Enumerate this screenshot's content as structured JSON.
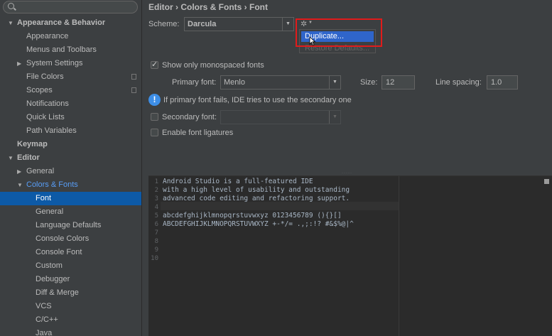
{
  "sidebar": {
    "search_placeholder": "",
    "items": [
      {
        "label": "Appearance & Behavior",
        "level": 0,
        "arrow": "▼",
        "bold": true
      },
      {
        "label": "Appearance",
        "level": 1
      },
      {
        "label": "Menus and Toolbars",
        "level": 1
      },
      {
        "label": "System Settings",
        "level": 1,
        "arrow": "▶"
      },
      {
        "label": "File Colors",
        "level": 1,
        "copy": true
      },
      {
        "label": "Scopes",
        "level": 1,
        "copy": true
      },
      {
        "label": "Notifications",
        "level": 1
      },
      {
        "label": "Quick Lists",
        "level": 1
      },
      {
        "label": "Path Variables",
        "level": 1
      },
      {
        "label": "Keymap",
        "level": 0,
        "bold": true
      },
      {
        "label": "Editor",
        "level": 0,
        "arrow": "▼",
        "bold": true
      },
      {
        "label": "General",
        "level": 1,
        "arrow": "▶"
      },
      {
        "label": "Colors & Fonts",
        "level": 1,
        "arrow": "▼"
      },
      {
        "label": "Font",
        "level": 2,
        "selected": true
      },
      {
        "label": "General",
        "level": 2
      },
      {
        "label": "Language Defaults",
        "level": 2
      },
      {
        "label": "Console Colors",
        "level": 2
      },
      {
        "label": "Console Font",
        "level": 2
      },
      {
        "label": "Custom",
        "level": 2
      },
      {
        "label": "Debugger",
        "level": 2
      },
      {
        "label": "Diff & Merge",
        "level": 2
      },
      {
        "label": "VCS",
        "level": 2
      },
      {
        "label": "C/C++",
        "level": 2
      },
      {
        "label": "Java",
        "level": 2
      }
    ]
  },
  "breadcrumb": "Editor › Colors & Fonts › Font",
  "scheme": {
    "label": "Scheme:",
    "value": "Darcula"
  },
  "gear_icon": "gear-icon",
  "popup": {
    "duplicate": "Duplicate...",
    "restore": "Restore Defaults..."
  },
  "options": {
    "mono_label": "Show only monospaced fonts",
    "mono_checked": true,
    "primary_label": "Primary font:",
    "primary_value": "Menlo",
    "size_label": "Size:",
    "size_value": "12",
    "spacing_label": "Line spacing:",
    "spacing_value": "1.0",
    "info_text": "If primary font fails, IDE tries to use the secondary one",
    "secondary_label": "Secondary font:",
    "secondary_checked": false,
    "ligatures_label": "Enable font ligatures",
    "ligatures_checked": false
  },
  "preview": {
    "lines": [
      {
        "num": "1",
        "text": "Android Studio is a full-featured IDE"
      },
      {
        "num": "2",
        "text": "with a high level of usability and outstanding"
      },
      {
        "num": "3",
        "text": "advanced code editing and refactoring support."
      },
      {
        "num": "4",
        "text": ""
      },
      {
        "num": "5",
        "text": "abcdefghijklmnopqrstuvwxyz 0123456789 (){}[]"
      },
      {
        "num": "6",
        "text": "ABCDEFGHIJKLMNOPQRSTUVWXYZ +-*/= .,;:!? #&$%@|^"
      },
      {
        "num": "7",
        "text": ""
      },
      {
        "num": "8",
        "text": ""
      },
      {
        "num": "9",
        "text": ""
      },
      {
        "num": "10",
        "text": ""
      }
    ]
  }
}
